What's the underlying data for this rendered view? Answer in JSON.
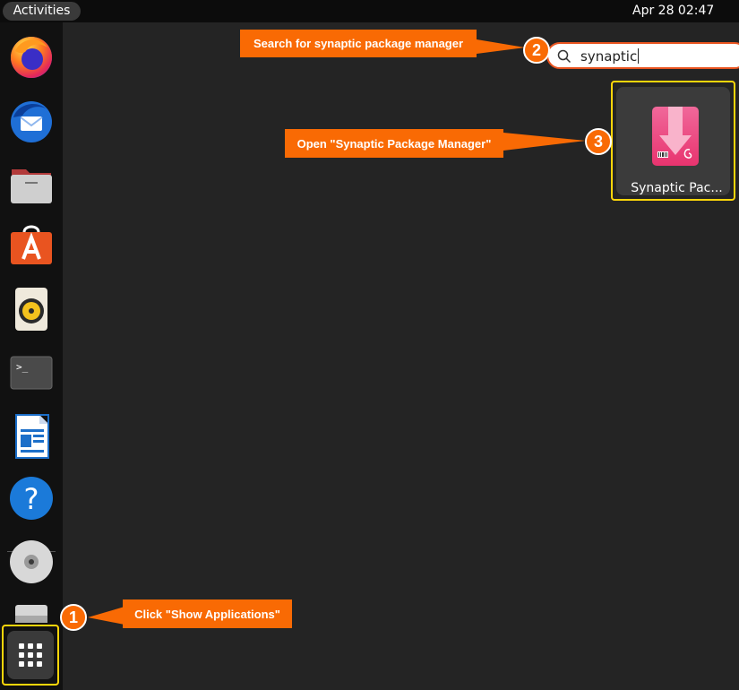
{
  "topbar": {
    "activities_label": "Activities",
    "clock": "Apr 28  02:47"
  },
  "dock": {
    "items": [
      {
        "name": "Firefox",
        "icon": "firefox-icon"
      },
      {
        "name": "Thunderbird",
        "icon": "thunderbird-icon"
      },
      {
        "name": "Files",
        "icon": "files-icon"
      },
      {
        "name": "Ubuntu Software",
        "icon": "software-store-icon"
      },
      {
        "name": "Rhythmbox",
        "icon": "rhythmbox-icon"
      },
      {
        "name": "Terminal",
        "icon": "terminal-icon"
      },
      {
        "name": "LibreOffice Writer",
        "icon": "writer-icon"
      },
      {
        "name": "Help",
        "icon": "help-icon"
      },
      {
        "name": "Disc",
        "icon": "disc-icon"
      },
      {
        "name": "Drive",
        "icon": "drive-icon"
      }
    ],
    "show_apps_icon": "grid-icon",
    "terminal_prompt": ">_",
    "help_glyph": "?"
  },
  "search": {
    "value": "synaptic"
  },
  "results": {
    "app_label": "Synaptic Pac..."
  },
  "annotations": {
    "step1": {
      "number": "1",
      "text": "Click \"Show Applications\""
    },
    "step2": {
      "number": "2",
      "text": "Search for synaptic package manager"
    },
    "step3": {
      "number": "3",
      "text": "Open \"Synaptic Package Manager\""
    }
  },
  "colors": {
    "accent": "#f96a04",
    "highlight": "#ffd60a",
    "ubuntu_orange": "#e95420"
  }
}
